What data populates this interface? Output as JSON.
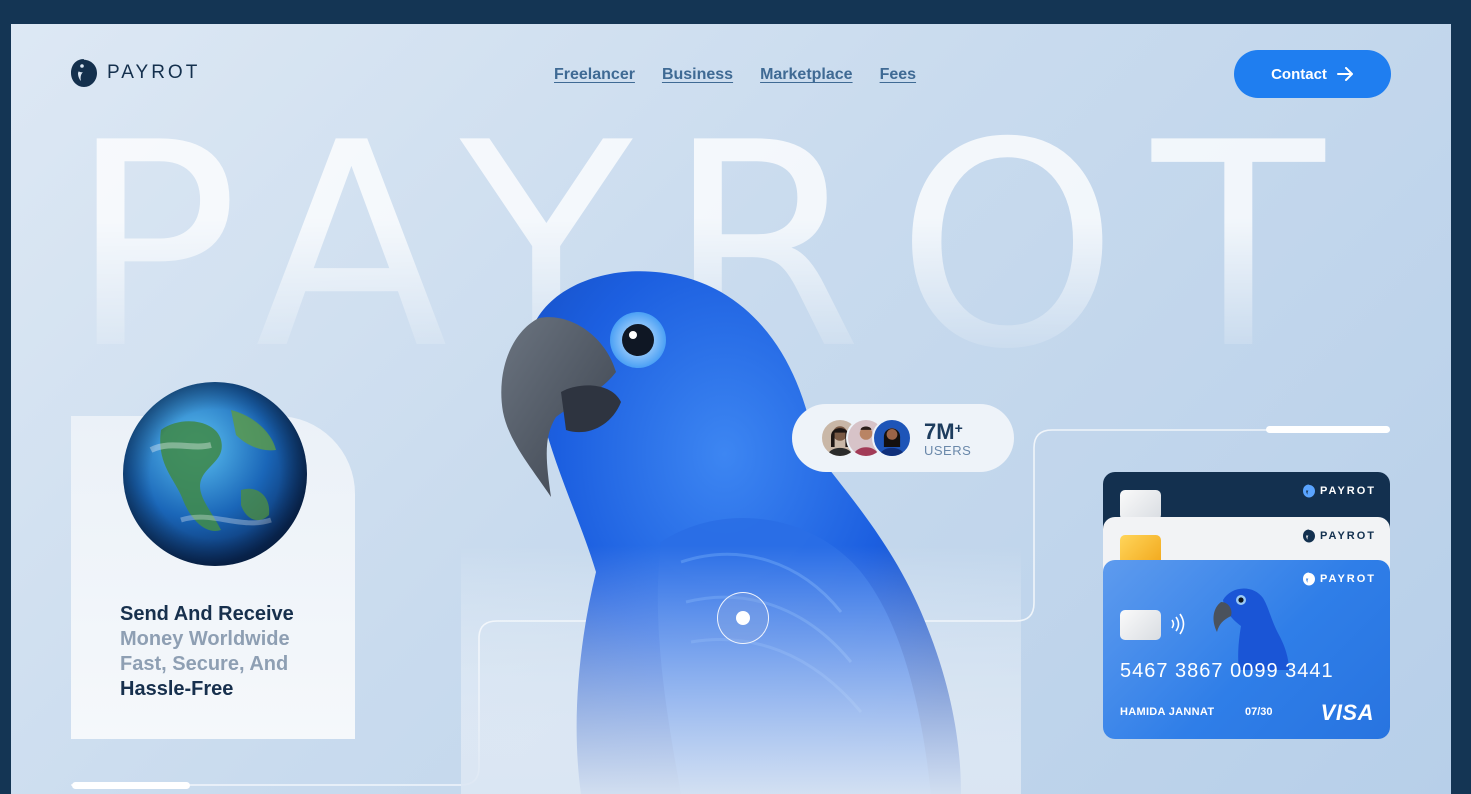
{
  "header": {
    "logo_text": "PAYROT",
    "nav": [
      "Freelancer",
      "Business",
      "Marketplace",
      "Fees"
    ],
    "contact_label": "Contact"
  },
  "hero": {
    "big_word": "PAYROT"
  },
  "info_card": {
    "line1": "Send And Receive",
    "line2": "Money Worldwide",
    "line3": "Fast, Secure, And",
    "line4": "Hassle-Free"
  },
  "users": {
    "count": "7M",
    "plus": "+",
    "label": "USERS"
  },
  "cards": {
    "brand": "PAYROT",
    "number": "5467 3867 0099 3441",
    "holder": "HAMIDA JANNAT",
    "expiry": "07/30",
    "network": "VISA"
  },
  "colors": {
    "accent": "#1f7ef0",
    "navy": "#13304f",
    "frame_bg": "#143554"
  },
  "icons": [
    "parrot-logo-icon",
    "arrow-right-icon",
    "nfc-icon",
    "globe-icon"
  ]
}
